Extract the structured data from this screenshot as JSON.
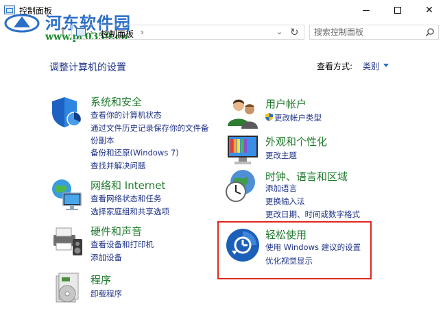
{
  "window": {
    "title": "控制面板"
  },
  "watermark": {
    "title": "河东软件园",
    "url": "www.pc0359.cn"
  },
  "address": {
    "path": "控制面板",
    "separator": "›"
  },
  "search": {
    "placeholder": "搜索控制面板"
  },
  "header": {
    "title": "调整计算机的设置",
    "view_label": "查看方式:",
    "view_value": "类别"
  },
  "categories": {
    "system": {
      "title": "系统和安全",
      "links": [
        "查看你的计算机状态",
        "通过文件历史记录保存你的文件备",
        "份副本",
        "备份和还原(Windows 7)",
        "查找并解决问题"
      ]
    },
    "network": {
      "title": "网络和 Internet",
      "links": [
        "查看网络状态和任务",
        "选择家庭组和共享选项"
      ]
    },
    "hardware": {
      "title": "硬件和声音",
      "links": [
        "查看设备和打印机",
        "添加设备"
      ]
    },
    "programs": {
      "title": "程序",
      "links": [
        "卸载程序"
      ]
    },
    "users": {
      "title": "用户帐户",
      "links": [
        "更改帐户类型"
      ]
    },
    "appearance": {
      "title": "外观和个性化",
      "links": [
        "更改主题"
      ]
    },
    "clock": {
      "title": "时钟、语言和区域",
      "links": [
        "添加语言",
        "更换输入法",
        "更改日期、时间或数字格式"
      ]
    },
    "ease": {
      "title": "轻松使用",
      "links": [
        "使用 Windows 建议的设置",
        "优化视觉显示"
      ]
    }
  },
  "colors": {
    "category_title": "#1f7a2c",
    "link": "#1e3287",
    "highlight": "#e0261d"
  }
}
